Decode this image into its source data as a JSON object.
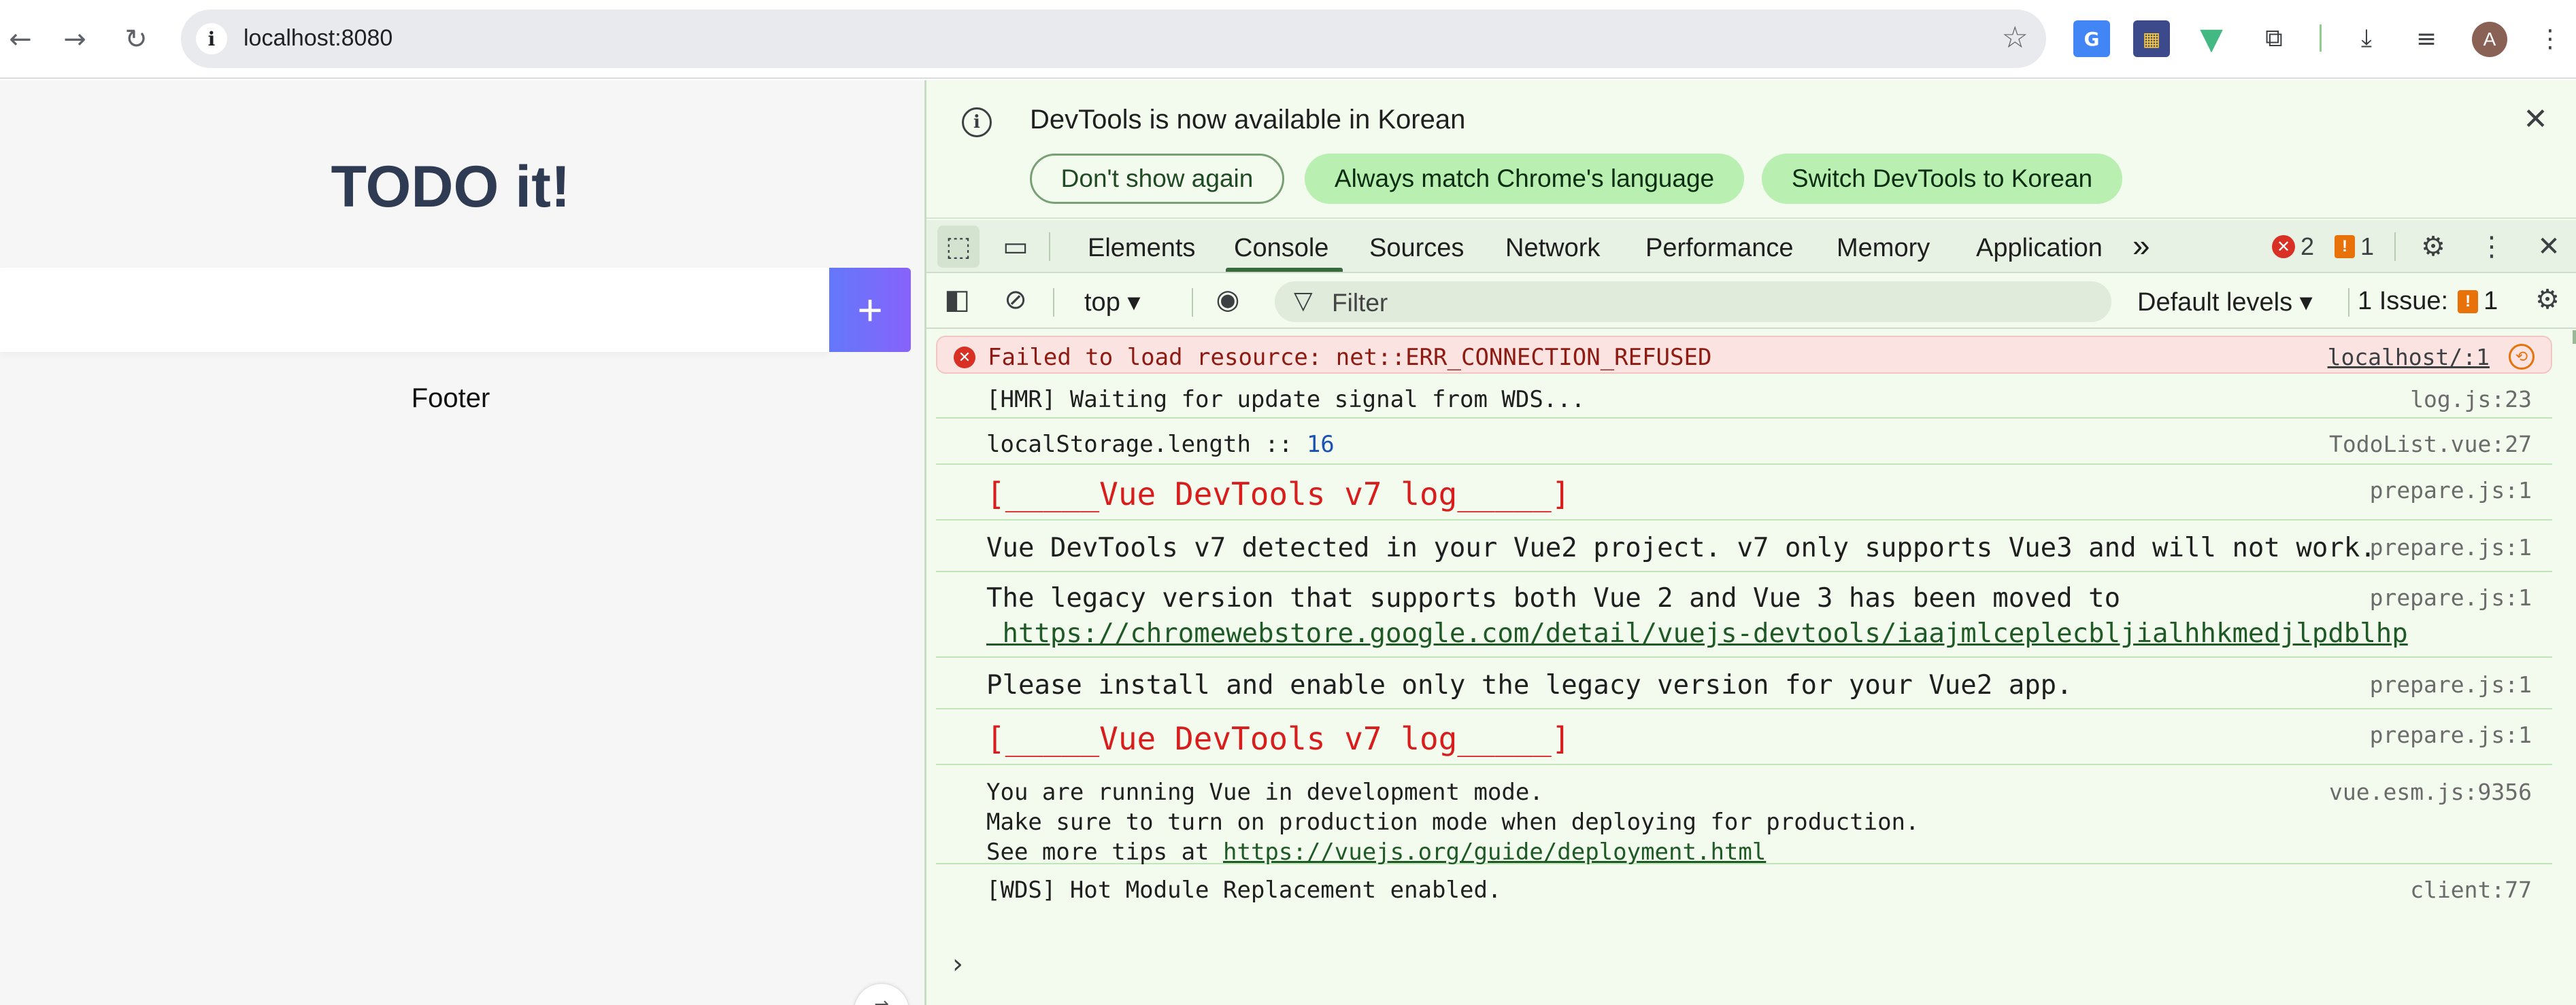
{
  "browser": {
    "url": "localhost:8080",
    "back_icon": "arrow-left",
    "forward_icon": "arrow-right",
    "reload_icon": "reload",
    "info_icon": "i",
    "star_icon": "star",
    "avatar_initial": "A"
  },
  "page": {
    "title": "TODO it!",
    "input_placeholder": "",
    "add_button": "+",
    "footer": "Footer"
  },
  "devtools": {
    "infobar": {
      "message": "DevTools is now available in Korean",
      "buttons": [
        "Don't show again",
        "Always match Chrome's language",
        "Switch DevTools to Korean"
      ]
    },
    "tabs": [
      "Elements",
      "Console",
      "Sources",
      "Network",
      "Performance",
      "Memory",
      "Application"
    ],
    "active_tab": "Console",
    "more_tabs": "»",
    "error_count": "2",
    "warning_count": "1",
    "toolbar": {
      "context": "top ▾",
      "filter_placeholder": "Filter",
      "levels": "Default levels ▾",
      "issues_label": "1 Issue:",
      "issues_count": "1"
    },
    "console": [
      {
        "type": "error",
        "text": "Failed to load resource: net::ERR_CONNECTION_REFUSED",
        "source": "localhost/:1"
      },
      {
        "type": "log",
        "text": "[HMR] Waiting for update signal from WDS...",
        "source": "log.js:23"
      },
      {
        "type": "log",
        "text": "localStorage.length :: ",
        "value": "16",
        "source": "TodoList.vue:27"
      },
      {
        "type": "styled",
        "text": "[_____Vue DevTools v7 log_____]",
        "source": "prepare.js:1"
      },
      {
        "type": "log",
        "text": "Vue DevTools v7 detected in your Vue2 project. v7 only supports Vue3 and will not work.",
        "source": "prepare.js:1"
      },
      {
        "type": "log",
        "text": "The legacy version that supports both Vue 2 and Vue 3 has been moved to",
        "link": " https://chromewebstore.google.com/detail/vuejs-devtools/iaajmlceplecbljialhhkmedjlpdblhp",
        "source": "prepare.js:1"
      },
      {
        "type": "log",
        "text": "Please install and enable only the legacy version for your Vue2 app.",
        "source": "prepare.js:1"
      },
      {
        "type": "styled",
        "text": "[_____Vue DevTools v7 log_____]",
        "source": "prepare.js:1"
      },
      {
        "type": "log",
        "lines": [
          "You are running Vue in development mode.",
          "Make sure to turn on production mode when deploying for production.",
          "See more tips at "
        ],
        "link": "https://vuejs.org/guide/deployment.html",
        "source": "vue.esm.js:9356"
      },
      {
        "type": "log",
        "text": "[WDS] Hot Module Replacement enabled.",
        "source": "client:77"
      }
    ],
    "prompt": "›"
  }
}
